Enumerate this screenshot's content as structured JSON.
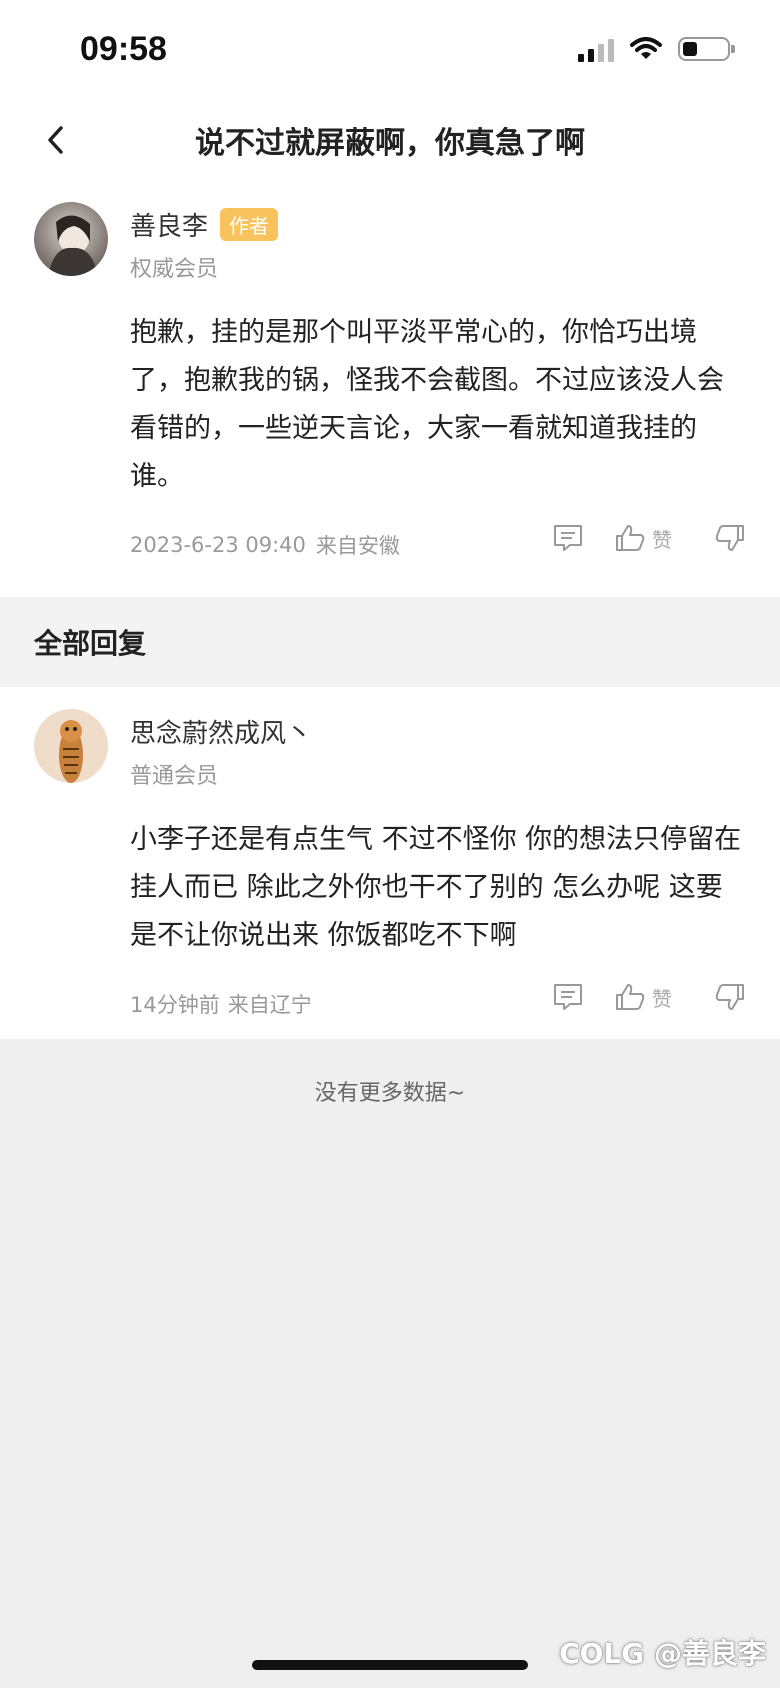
{
  "status_bar": {
    "time": "09:58"
  },
  "nav": {
    "title": "说不过就屏蔽啊，你真急了啊"
  },
  "post": {
    "author": "善良李",
    "badge": "作者",
    "level": "权威会员",
    "content": "抱歉，挂的是那个叫平淡平常心的，你恰巧出境了，抱歉我的锅，怪我不会截图。不过应该没人会看错的，一些逆天言论，大家一看就知道我挂的谁。",
    "time": "2023-6-23 09:40",
    "location": "来自安徽",
    "like_label": "赞"
  },
  "section": {
    "title": "全部回复"
  },
  "reply": {
    "author": "思念蔚然成风丶",
    "level": "普通会员",
    "content": "小李子还是有点生气 不过不怪你  你的想法只停留在挂人而已  除此之外你也干不了别的  怎么办呢  这要是不让你说出来  你饭都吃不下啊",
    "time": "14分钟前",
    "location": "来自辽宁",
    "like_label": "赞"
  },
  "footer": {
    "no_more": "没有更多数据~"
  },
  "watermark": "COLG @善良李",
  "icons": [
    "back-icon",
    "signal-icon",
    "wifi-icon",
    "battery-icon",
    "comment-icon",
    "thumb-up-icon",
    "thumb-down-icon"
  ],
  "colors": {
    "badge": "#f8c35d",
    "background": "#efefef",
    "card": "#ffffff"
  }
}
